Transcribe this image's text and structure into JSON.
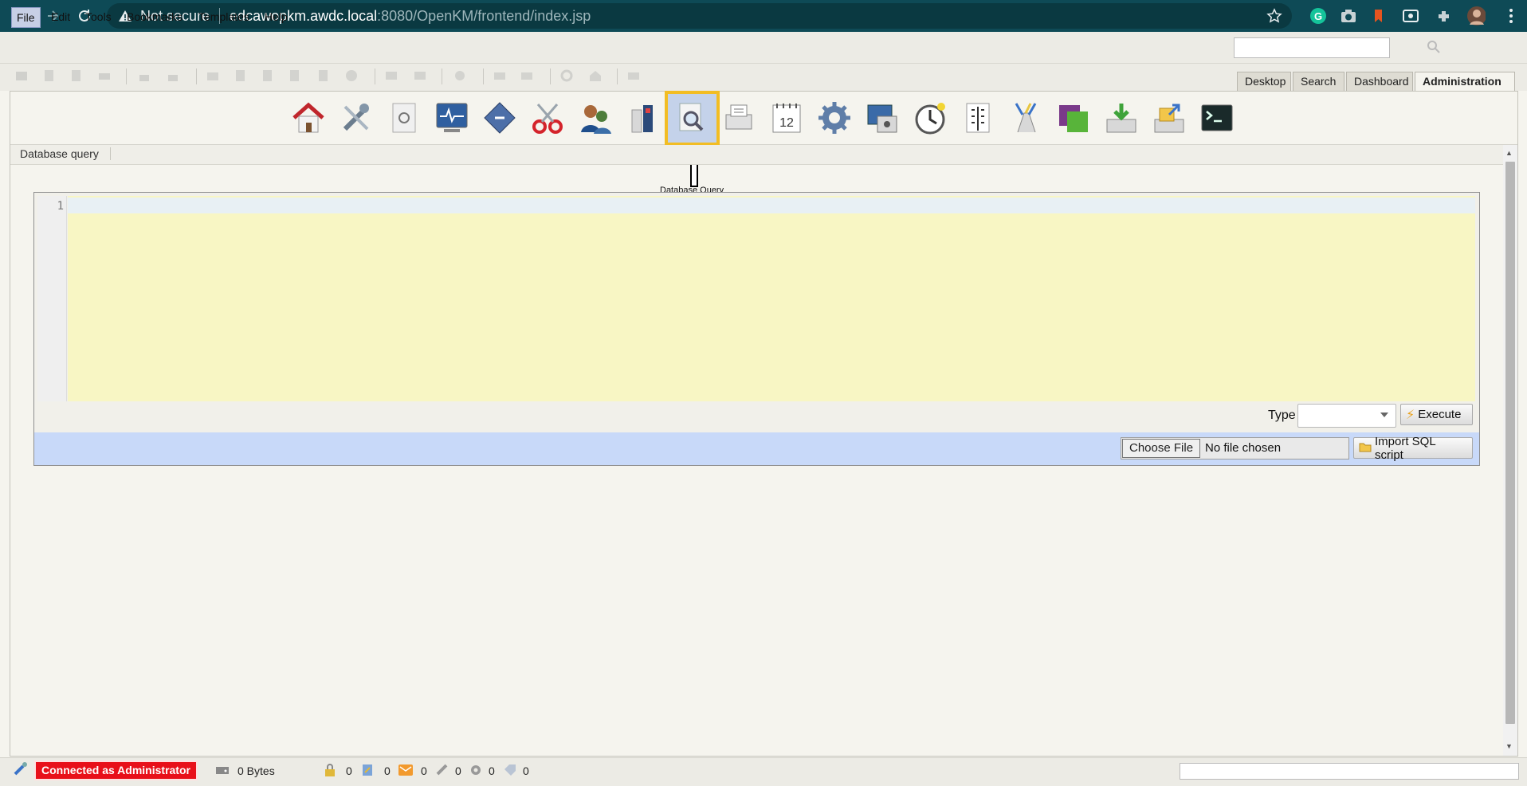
{
  "browser": {
    "security_label": "Not secure",
    "url_host": "edcawopkm.awdc.local",
    "url_path": ":8080/OpenKM/frontend/index.jsp"
  },
  "menu": {
    "items": [
      "File",
      "Edit",
      "Tools",
      "Bookmarks",
      "Templates",
      "Help"
    ]
  },
  "tabs": [
    "Desktop",
    "Search",
    "Dashboard",
    "Administration"
  ],
  "breadcrumb": "Database query",
  "tooltip": "Database Query",
  "editor": {
    "line_number": "1"
  },
  "query_form": {
    "type_label": "Type",
    "type_value": "",
    "execute_label": "Execute",
    "choose_file_label": "Choose File",
    "no_file_label": "No file chosen",
    "import_label": "Import SQL script"
  },
  "status": {
    "connected": "Connected as Administrator",
    "size": "0 Bytes",
    "locked_count": "0",
    "checkout_count": "0",
    "mail_count": "0",
    "subscribed_count": "0",
    "workflow_count": "0",
    "proposed_count": "0"
  },
  "colors": {
    "chrome": "#0e4a56",
    "highlight": "#f2bd24",
    "editor_bg": "#f8f6c4",
    "import_bar": "#c8d9f9",
    "connected_badge": "#e8101a"
  }
}
